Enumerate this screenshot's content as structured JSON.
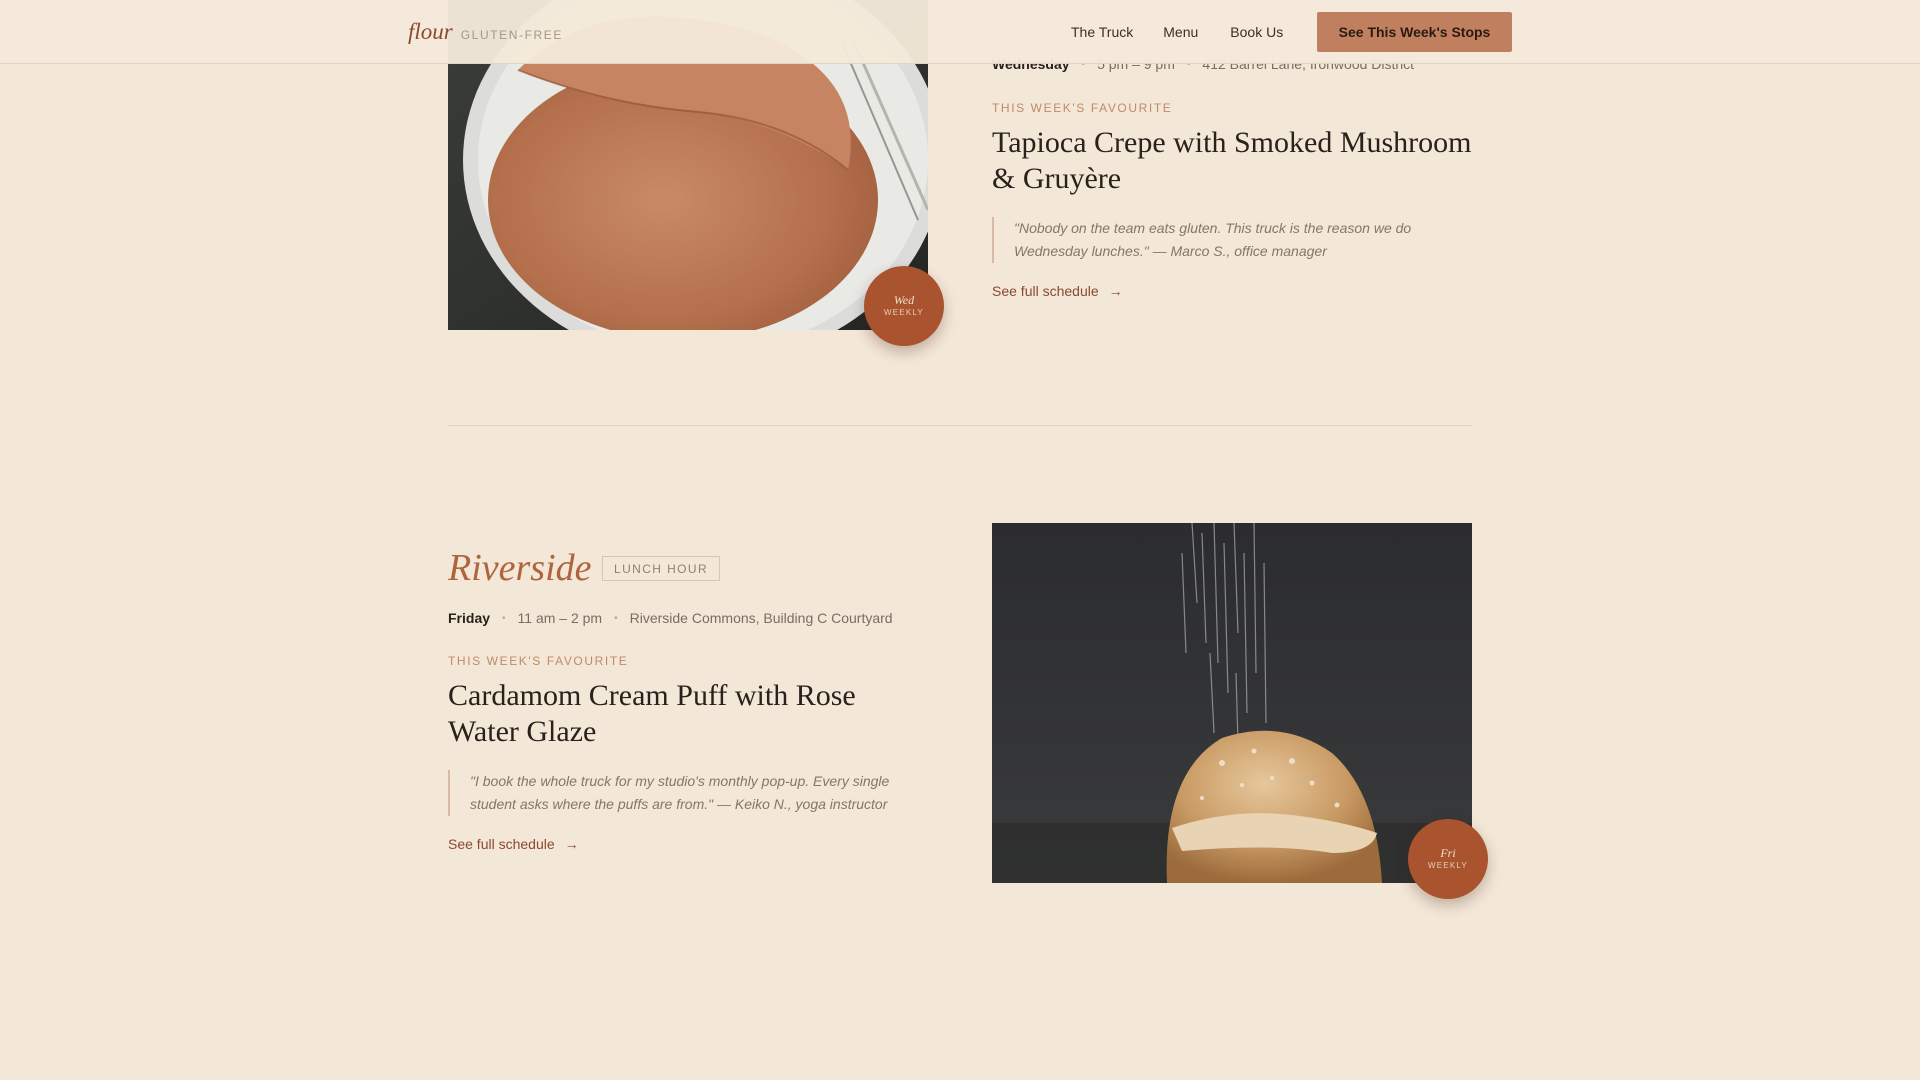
{
  "header": {
    "brand_name": "flour",
    "brand_tag": "GLUTEN-FREE",
    "nav": [
      "The Truck",
      "Menu",
      "Book Us"
    ],
    "cta": "See This Week's Stops"
  },
  "stop1": {
    "day": "Wednesday",
    "time": "5 pm – 9 pm",
    "location": "412 Barrel Lane, Ironwood District",
    "fav_label": "THIS WEEK'S FAVOURITE",
    "dish_line1": "Tapioca Crepe with Smoked Mushroom",
    "dish_line2": "& Gruyère",
    "quote_line1": "\"Nobody on the team eats gluten. This truck is the reason we do",
    "quote_line2": "Wednesday lunches.\" — Marco S., office manager",
    "link": "See full schedule",
    "badge_day": "Wed",
    "badge_freq": "WEEKLY"
  },
  "stop2": {
    "name": "Riverside",
    "tag": "LUNCH HOUR",
    "day": "Friday",
    "time": "11 am – 2 pm",
    "location": "Riverside Commons, Building C Courtyard",
    "fav_label": "THIS WEEK'S FAVOURITE",
    "dish_line1": "Cardamom Cream Puff with Rose",
    "dish_line2": "Water Glaze",
    "quote_line1": "\"I book the whole truck for my studio's monthly pop-up. Every single",
    "quote_line2": "student asks where the puffs are from.\" — Keiko N., yoga instructor",
    "link": "See full schedule",
    "badge_day": "Fri",
    "badge_freq": "WEEKLY"
  },
  "colors": {
    "background": "#f3e7d7",
    "accent": "#a9532f",
    "cta": "#c0805f",
    "heading": "#b0643e"
  },
  "icons": {
    "link_arrow": "arrow-right-icon"
  }
}
